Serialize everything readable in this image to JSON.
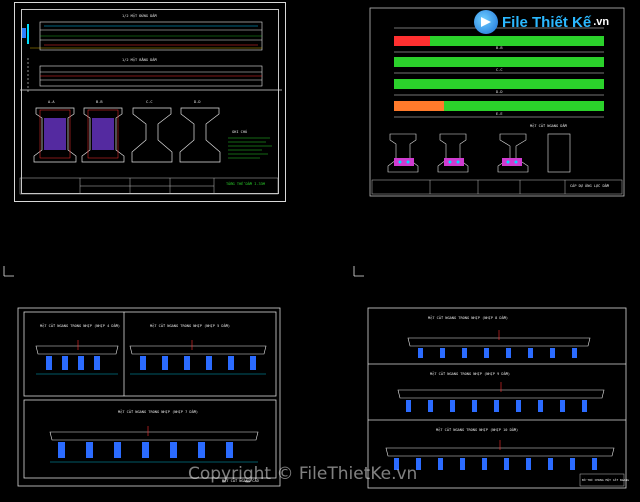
{
  "logo": {
    "text": "File Thiết Kế",
    "suffix": ".vn"
  },
  "watermark": "Copyright © FileThietKe.vn",
  "sheets": {
    "top_left": {
      "title1": "1/2 MẶT ĐỨNG DẦM",
      "title2": "1/2 MẶT BẰNG DẦM",
      "sections": [
        "A-A",
        "B-B",
        "C-C",
        "D-D"
      ],
      "notes_title": "GHI CHÚ",
      "sheet_title": "TỔNG THỂ DẦM I-33M"
    },
    "top_right": {
      "labels": [
        "B-B",
        "C-C",
        "D-D",
        "E-E"
      ],
      "section_title": "MẶT CẮT NGANG DẦM",
      "sheet_title": "CÁP DỰ ỨNG LỰC DẦM"
    },
    "bottom_left": {
      "title_a": "MẶT CẮT NGANG TRONG NHỊP (NHỊP 4 DẦM)",
      "title_b": "MẶT CẮT NGANG TRONG NHỊP (NHỊP 5 DẦM)",
      "title_c": "MẶT CẮT NGANG TRONG NHỊP (NHỊP 7 DẦM)",
      "sheet_title": "MẶT CẮT NGANG CẦU"
    },
    "bottom_right": {
      "title_a": "MẶT CẮT NGANG TRONG NHỊP (NHỊP 8 DẦM)",
      "title_b": "MẶT CẮT NGANG TRONG NHỊP (NHỊP 9 DẦM)",
      "title_c": "MẶT CẮT NGANG TRONG NHỊP (NHỊP 10 DẦM)",
      "sheet_title": "BỐ TRÍ CHUNG MẶT CẮT NGANG"
    }
  }
}
